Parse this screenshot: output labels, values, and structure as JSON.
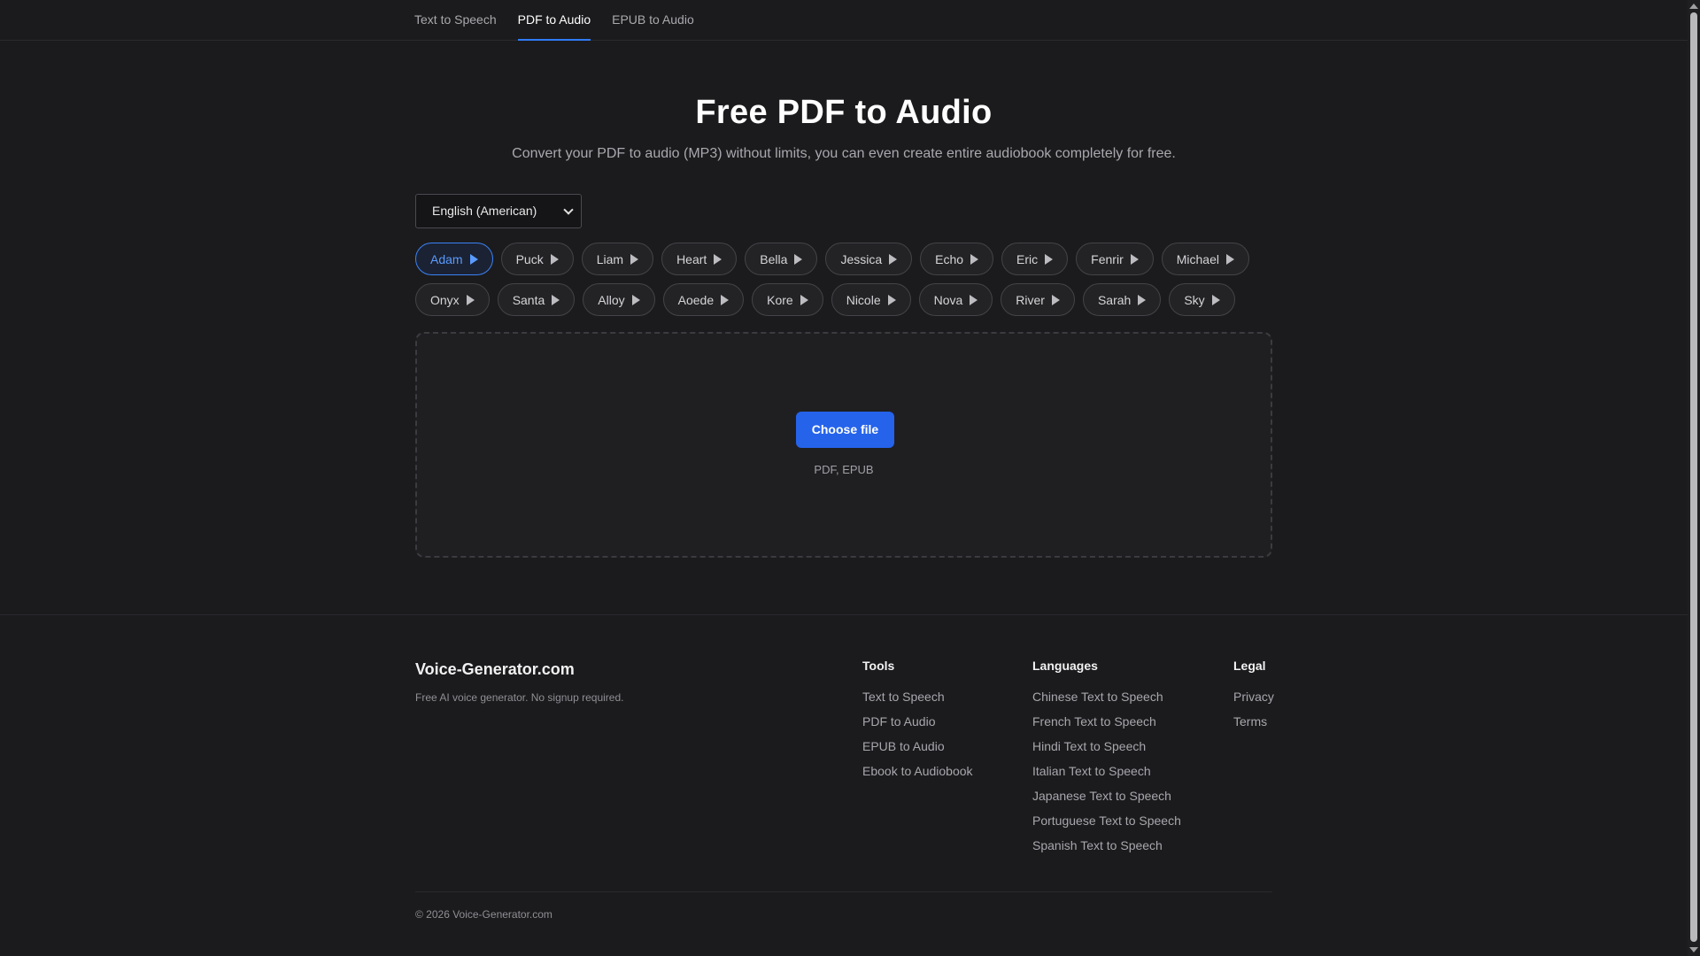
{
  "nav": {
    "tabs": [
      {
        "label": "Text to Speech",
        "active": false
      },
      {
        "label": "PDF to Audio",
        "active": true
      },
      {
        "label": "EPUB to Audio",
        "active": false
      }
    ]
  },
  "hero": {
    "title": "Free PDF to Audio",
    "subtitle": "Convert your PDF to audio (MP3) without limits, you can even create entire audiobook completely for free."
  },
  "language_select": {
    "selected": "English (American)"
  },
  "voices": {
    "selected": "Adam",
    "row1": [
      "Adam",
      "Puck",
      "Liam",
      "Heart",
      "Bella",
      "Jessica",
      "Echo",
      "Eric",
      "Fenrir",
      "Michael"
    ],
    "row2": [
      "Onyx",
      "Santa",
      "Alloy",
      "Aoede",
      "Kore",
      "Nicole",
      "Nova",
      "River",
      "Sarah",
      "Sky"
    ],
    "icon": "play-icon"
  },
  "upload": {
    "button_label": "Choose file",
    "formats": "PDF, EPUB"
  },
  "footer": {
    "brand": "Voice-Generator.com",
    "tagline": "Free AI voice generator. No signup required.",
    "tools": {
      "heading": "Tools",
      "links": [
        "Text to Speech",
        "PDF to Audio",
        "EPUB to Audio",
        "Ebook to Audiobook"
      ]
    },
    "languages": {
      "heading": "Languages",
      "links": [
        "Chinese Text to Speech",
        "French Text to Speech",
        "Hindi Text to Speech",
        "Italian Text to Speech",
        "Japanese Text to Speech",
        "Portuguese Text to Speech",
        "Spanish Text to Speech"
      ]
    },
    "legal": {
      "heading": "Legal",
      "links": [
        "Privacy",
        "Terms"
      ]
    },
    "copyright": "© 2026 Voice-Generator.com"
  },
  "colors": {
    "background": "#1b1b1d",
    "accent": "#2563eb",
    "selected_voice": "#5a9bff"
  }
}
